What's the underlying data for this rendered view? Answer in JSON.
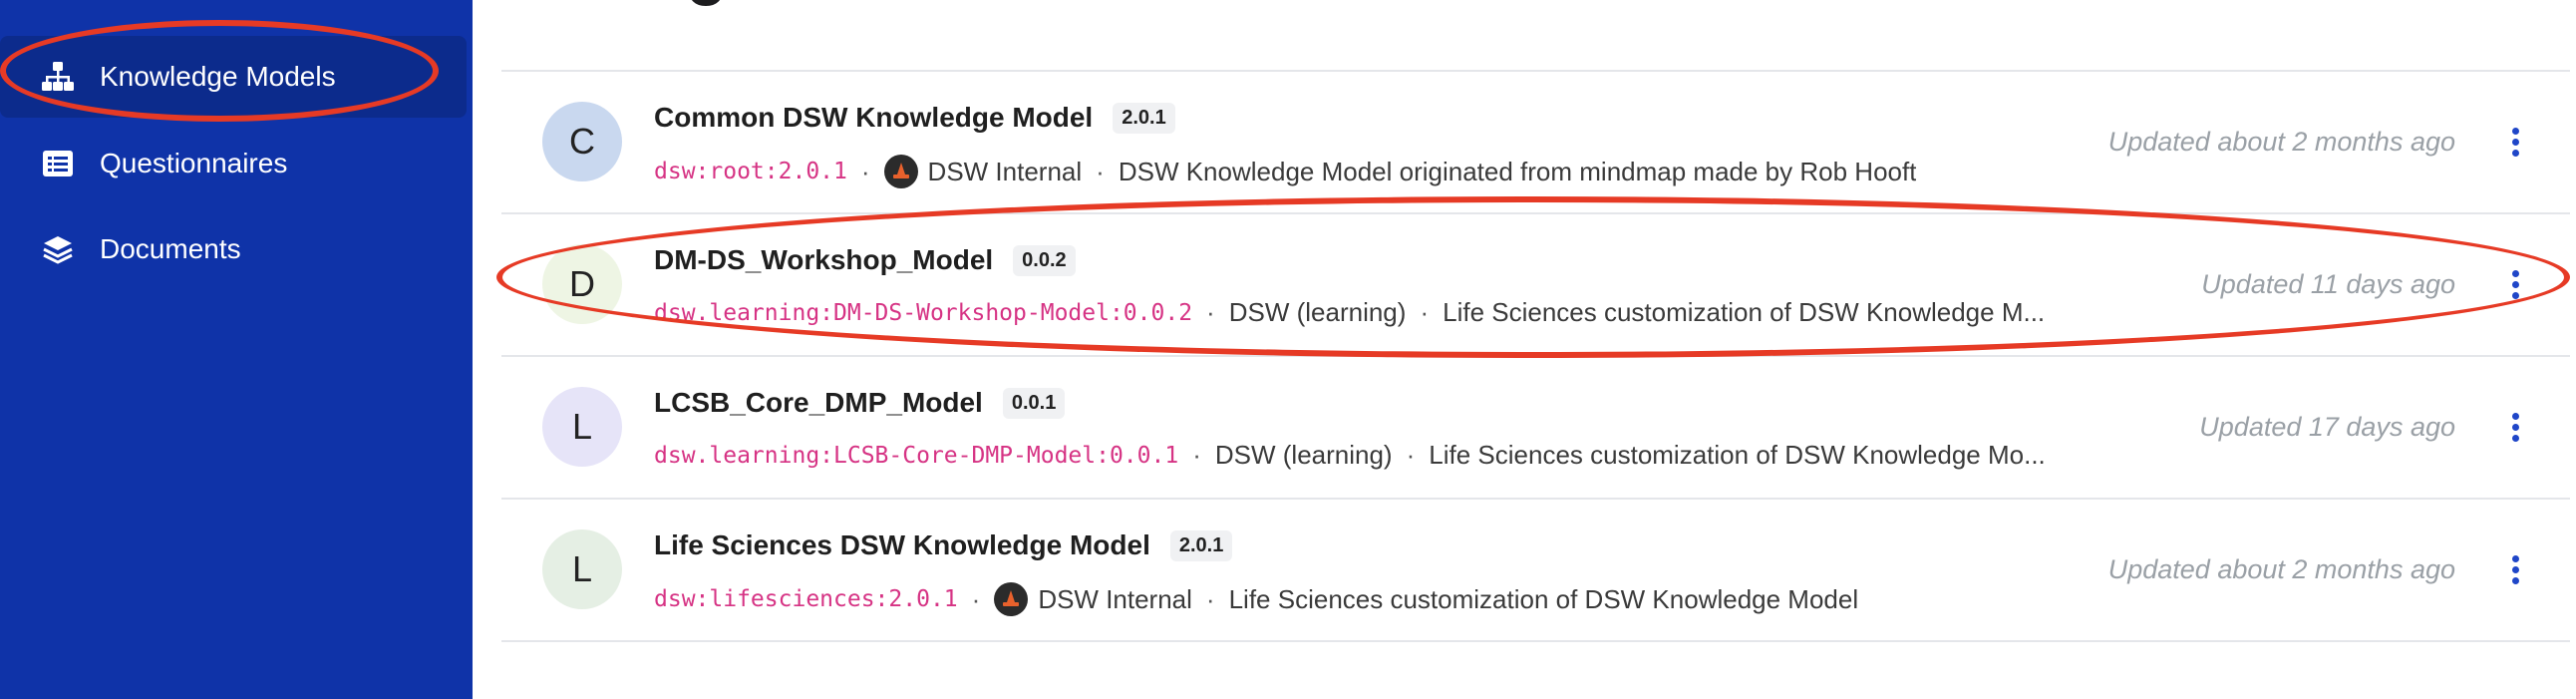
{
  "sidebar": {
    "items": [
      {
        "label": "Knowledge Models",
        "icon": "sitemap-icon"
      },
      {
        "label": "Questionnaires",
        "icon": "list-icon"
      },
      {
        "label": "Documents",
        "icon": "layers-icon"
      }
    ],
    "active_index": 0
  },
  "colors": {
    "sidebar_bg": "#0f33a8",
    "annotation": "#e63a25",
    "id_text": "#d63384",
    "menu_dots": "#1f46c8"
  },
  "list": {
    "items": [
      {
        "avatar": "C",
        "avatar_color": "#c9d8ef",
        "name": "Common DSW Knowledge Model",
        "version": "2.0.1",
        "id": "dsw:root:2.0.1",
        "organization": "DSW Internal",
        "description": "DSW Knowledge Model originated from mindmap made by Rob Hooft",
        "updated": "Updated about 2 months ago"
      },
      {
        "avatar": "D",
        "avatar_color": "#eef5e4",
        "name": "DM-DS_Workshop_Model",
        "version": "0.0.2",
        "id": "dsw.learning:DM-DS-Workshop-Model:0.0.2",
        "organization": "DSW (learning)",
        "description": "Life Sciences customization of DSW Knowledge M...",
        "updated": "Updated 11 days ago"
      },
      {
        "avatar": "L",
        "avatar_color": "#e6e4f8",
        "name": "LCSB_Core_DMP_Model",
        "version": "0.0.1",
        "id": "dsw.learning:LCSB-Core-DMP-Model:0.0.1",
        "organization": "DSW (learning)",
        "description": "Life Sciences customization of DSW Knowledge Mo...",
        "updated": "Updated 17 days ago"
      },
      {
        "avatar": "L",
        "avatar_color": "#e5efe4",
        "name": "Life Sciences DSW Knowledge Model",
        "version": "2.0.1",
        "id": "dsw:lifesciences:2.0.1",
        "organization": "DSW Internal",
        "description": "Life Sciences customization of DSW Knowledge Model",
        "updated": "Updated about 2 months ago"
      }
    ]
  },
  "separator": "·"
}
